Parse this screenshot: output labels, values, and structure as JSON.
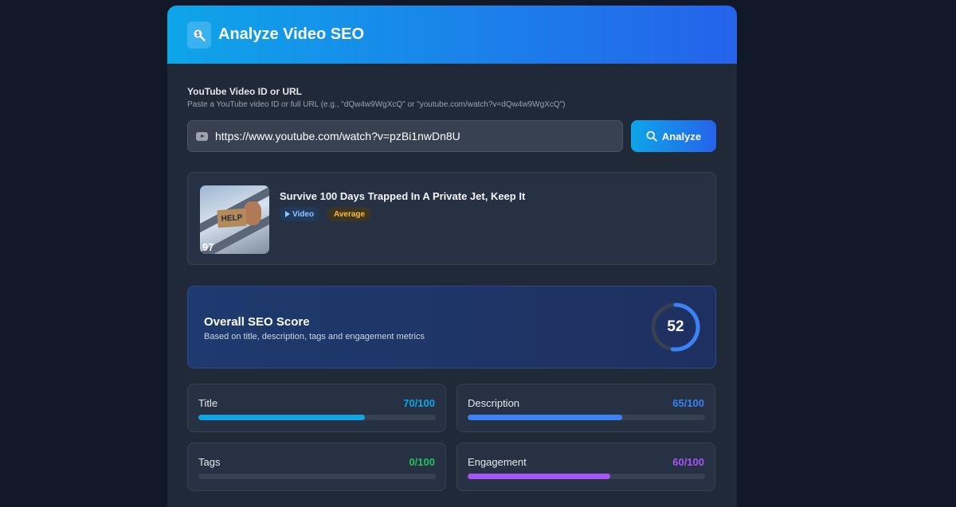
{
  "header": {
    "title": "Analyze Video SEO",
    "icon": "search-dollar-icon"
  },
  "form": {
    "label": "YouTube Video ID or URL",
    "hint": "Paste a YouTube video ID or full URL (e.g., \"dQw4w9WgXcQ\" or \"youtube.com/watch?v=dQw4w9WgXcQ\")",
    "input_value": "https://www.youtube.com/watch?v=pzBi1nwDn8U",
    "input_icon": "youtube-icon",
    "button_label": "Analyze"
  },
  "video": {
    "title": "Survive 100 Days Trapped In A Private Jet, Keep It",
    "type_badge": "Video",
    "rating_badge": "Average",
    "thumbnail_sign": "HELP",
    "thumbnail_number": "97"
  },
  "overall": {
    "title": "Overall SEO Score",
    "subtitle": "Based on title, description, tags and engagement metrics",
    "score": "52",
    "score_fraction": 0.52
  },
  "metrics": [
    {
      "name": "Title",
      "value": "70/100",
      "fraction": 0.7,
      "color": "#0ea5e9"
    },
    {
      "name": "Description",
      "value": "65/100",
      "fraction": 0.65,
      "color": "#3b82f6"
    },
    {
      "name": "Tags",
      "value": "0/100",
      "fraction": 0.0,
      "color": "#22c55e"
    },
    {
      "name": "Engagement",
      "value": "60/100",
      "fraction": 0.6,
      "color": "#a855f7"
    }
  ],
  "colors": {
    "accent": "#2563eb",
    "accent_light": "#0ea5e9",
    "average": "#fbbf24"
  }
}
